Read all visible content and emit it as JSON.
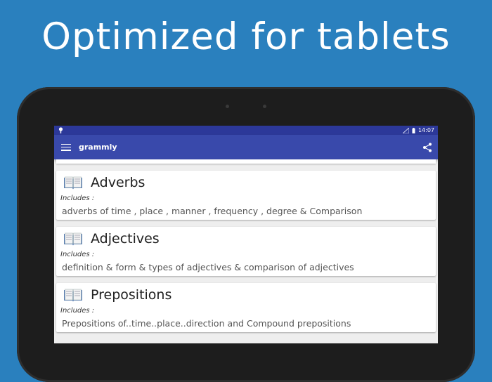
{
  "headline": "Optimized for tablets",
  "status": {
    "time": "14:07"
  },
  "appbar": {
    "title": "grammly"
  },
  "cards": [
    {
      "title": "Adverbs",
      "includes": "Includes :",
      "desc": "adverbs of time , place , manner , frequency , degree & Comparison"
    },
    {
      "title": "Adjectives",
      "includes": "Includes :",
      "desc": "definition & form & types of adjectives & comparison of adjectives"
    },
    {
      "title": "Prepositions",
      "includes": "Includes :",
      "desc": "Prepositions of..time..place..direction and Compound prepositions"
    }
  ],
  "colors": {
    "background": "#2a80be",
    "appbar": "#3949ab",
    "statusbar": "#2c3899"
  },
  "icons": [
    "menu-icon",
    "share-icon",
    "book-icon"
  ]
}
